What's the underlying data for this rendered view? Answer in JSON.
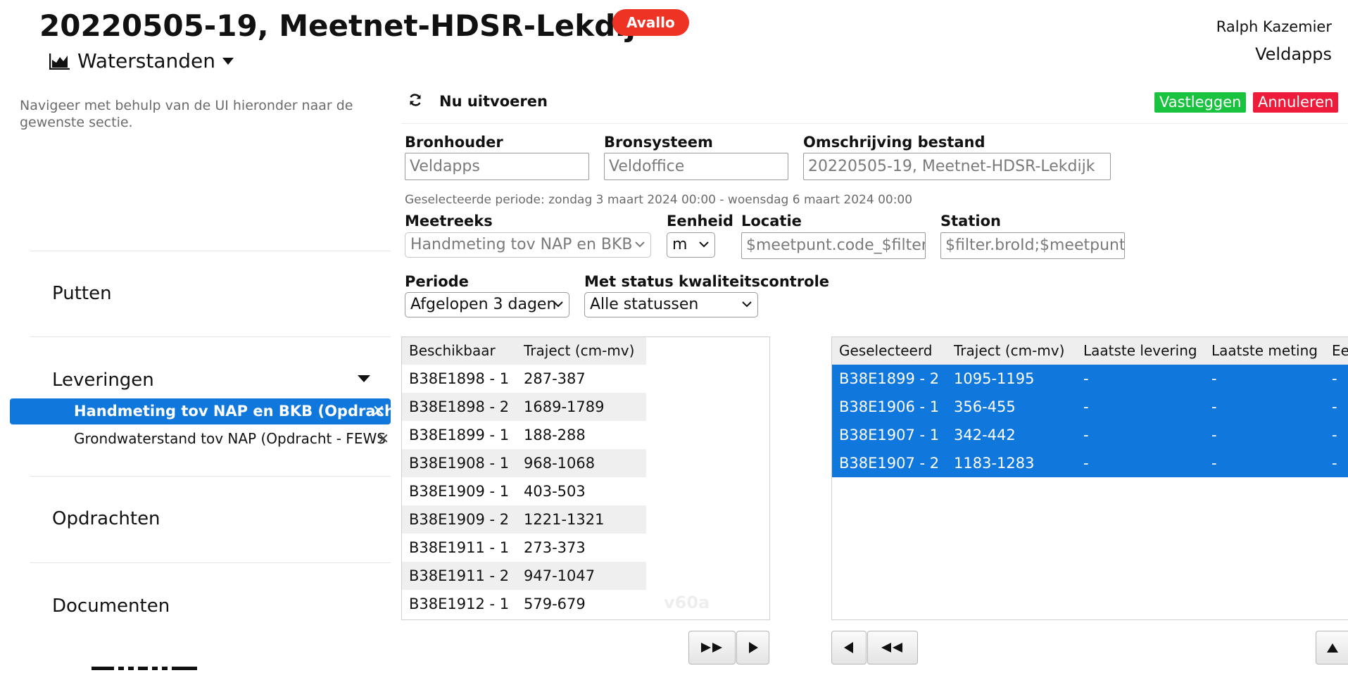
{
  "header": {
    "title": "20220505-19, Meetnet-HDSR-Lekdijk",
    "badge": "Avallo",
    "section_label": "Waterstanden",
    "user_name": "Ralph Kazemier",
    "organization": "Veldapps"
  },
  "sidebar": {
    "hint": "Navigeer met behulp van de UI hieronder naar de gewenste sectie.",
    "sections": [
      {
        "label": "Putten"
      },
      {
        "label": "Leveringen"
      },
      {
        "label": "Opdrachten"
      },
      {
        "label": "Documenten"
      }
    ],
    "leveringen_items": [
      {
        "label": "Handmeting tov NAP en BKB (Opdracht",
        "active": true
      },
      {
        "label": "Grondwaterstand tov NAP (Opdracht - FEWS",
        "active": false
      }
    ]
  },
  "toolbar": {
    "run_label": "Nu uitvoeren",
    "commit_label": "Vastleggen",
    "cancel_label": "Annuleren",
    "colors": {
      "commit": "#19c33f",
      "cancel": "#ee1b3a",
      "accent": "#1077dd",
      "badge": "#ee3324"
    }
  },
  "form": {
    "bronhouder": {
      "label": "Bronhouder",
      "value": "Veldapps"
    },
    "bronsysteem": {
      "label": "Bronsysteem",
      "value": "Veldoffice"
    },
    "omschrijving": {
      "label": "Omschrijving bestand",
      "value": "20220505-19, Meetnet-HDSR-Lekdijk"
    },
    "period_text": "Geselecteerde periode: zondag 3 maart 2024 00:00 - woensdag 6 maart 2024 00:00",
    "meetreeks": {
      "label": "Meetreeks",
      "value": "Handmeting tov NAP en BKB"
    },
    "eenheid": {
      "label": "Eenheid",
      "value": "m"
    },
    "locatie": {
      "label": "Locatie",
      "value": "$meetpunt.code_$filter.r"
    },
    "station": {
      "label": "Station",
      "value": "$filter.broId;$meetpunt.b"
    },
    "periode": {
      "label": "Periode",
      "value": "Afgelopen 3 dagen"
    },
    "status": {
      "label": "Met status kwaliteitscontrole",
      "value": "Alle statussen"
    }
  },
  "available": {
    "headers": [
      "Beschikbaar",
      "Traject (cm-mv)"
    ],
    "rows": [
      [
        "B38E1898 - 1",
        "287-387"
      ],
      [
        "B38E1898 - 2",
        "1689-1789"
      ],
      [
        "B38E1899 - 1",
        "188-288"
      ],
      [
        "B38E1908 - 1",
        "968-1068"
      ],
      [
        "B38E1909 - 1",
        "403-503"
      ],
      [
        "B38E1909 - 2",
        "1221-1321"
      ],
      [
        "B38E1911 - 1",
        "273-373"
      ],
      [
        "B38E1911 - 2",
        "947-1047"
      ],
      [
        "B38E1912 - 1",
        "579-679"
      ]
    ],
    "watermark": "v60a"
  },
  "selected": {
    "headers": [
      "Geselecteerd",
      "Traject (cm-mv)",
      "Laatste levering",
      "Laatste meting",
      "Ee"
    ],
    "rows": [
      [
        "B38E1899 - 2",
        "1095-1195",
        "-",
        "-",
        "-"
      ],
      [
        "B38E1906 - 1",
        "356-455",
        "-",
        "-",
        "-"
      ],
      [
        "B38E1907 - 1",
        "342-442",
        "-",
        "-",
        "-"
      ],
      [
        "B38E1907 - 2",
        "1183-1283",
        "-",
        "-",
        "-"
      ]
    ]
  }
}
